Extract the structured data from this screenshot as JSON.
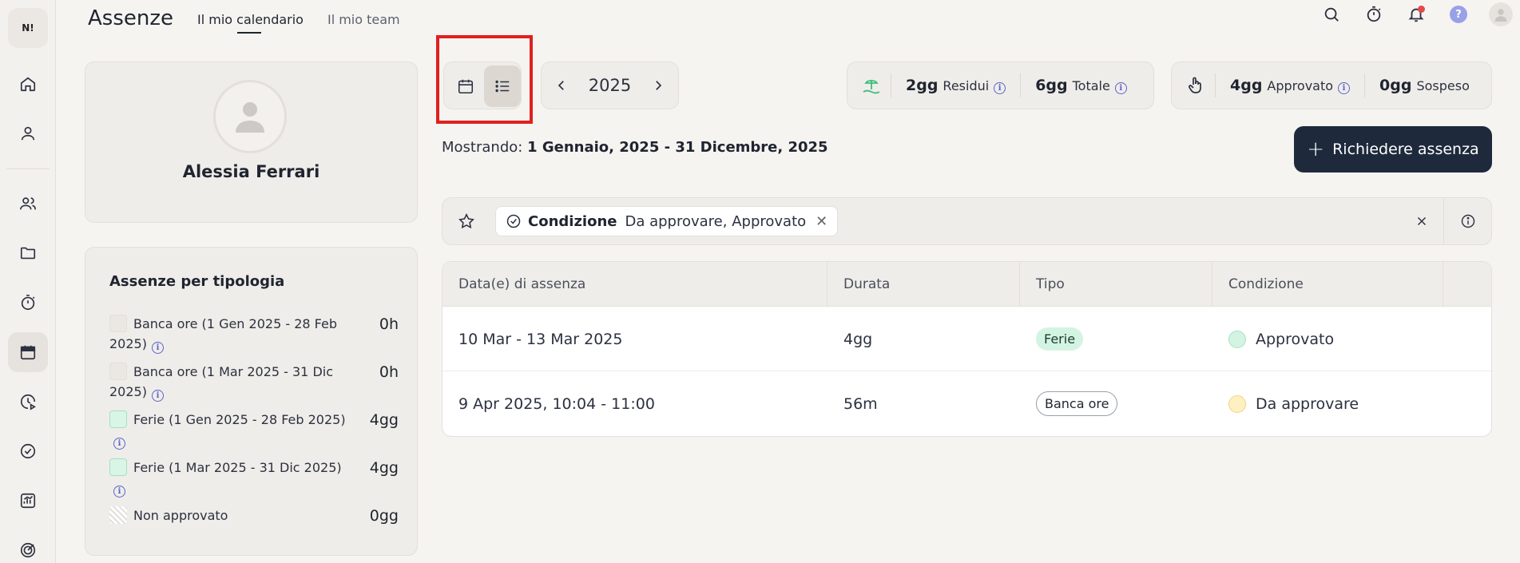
{
  "app": {
    "logo_text": "N!",
    "page_title": "Assenze",
    "tabs": [
      "Il mio calendario",
      "Il mio team"
    ]
  },
  "profile": {
    "name": "Alessia Ferrari"
  },
  "types": {
    "title": "Assenze per tipologia",
    "rows": [
      {
        "label": "Banca ore (1 Gen 2025 - 28 Feb 2025)",
        "value": "0h",
        "swatch": "empty"
      },
      {
        "label": "Banca ore (1 Mar 2025 - 31 Dic 2025)",
        "value": "0h",
        "swatch": "empty"
      },
      {
        "label": "Ferie (1 Gen 2025 - 28 Feb 2025)",
        "value": "4gg",
        "swatch": "green"
      },
      {
        "label": "Ferie (1 Mar 2025 - 31 Dic 2025)",
        "value": "4gg",
        "swatch": "green"
      },
      {
        "label": "Non approvato",
        "value": "0gg",
        "swatch": "hatch"
      }
    ]
  },
  "year_nav": {
    "year": "2025"
  },
  "balance": {
    "residui_value": "2gg",
    "residui_label": "Residui",
    "totale_value": "6gg",
    "totale_label": "Totale"
  },
  "approval": {
    "approvato_value": "4gg",
    "approvato_label": "Approvato",
    "sospeso_value": "0gg",
    "sospeso_label": "Sospeso"
  },
  "showing": {
    "prefix": "Mostrando:",
    "range": "1 Gennaio, 2025 - 31 Dicembre, 2025"
  },
  "request_button": {
    "label": "Richiedere assenza"
  },
  "filter": {
    "chip_label": "Condizione",
    "chip_value": "Da approvare, Approvato"
  },
  "table": {
    "columns": [
      "Data(e) di assenza",
      "Durata",
      "Tipo",
      "Condizione"
    ],
    "rows": [
      {
        "date": "10 Mar - 13 Mar 2025",
        "duration": "4gg",
        "type": "Ferie",
        "status": "Approvato"
      },
      {
        "date": "9 Apr 2025, 10:04 - 11:00",
        "duration": "56m",
        "type": "Banca ore",
        "status": "Da approvare"
      }
    ]
  },
  "icons": {
    "rail": [
      "home-icon",
      "user-icon",
      "users-icon",
      "folder-icon",
      "stopwatch-icon",
      "calendar-icon",
      "clock-play-icon",
      "check-circle-icon",
      "chart-icon",
      "target-icon"
    ],
    "top": [
      "search-icon",
      "stopwatch-icon",
      "bell-icon",
      "help-icon",
      "avatar-icon"
    ]
  },
  "colors": {
    "primary_button": "#1e2a3c",
    "approved": "#d3f4e3",
    "pending": "#fff0c2",
    "highlight": "#e02020",
    "notification": "#e5484d"
  }
}
